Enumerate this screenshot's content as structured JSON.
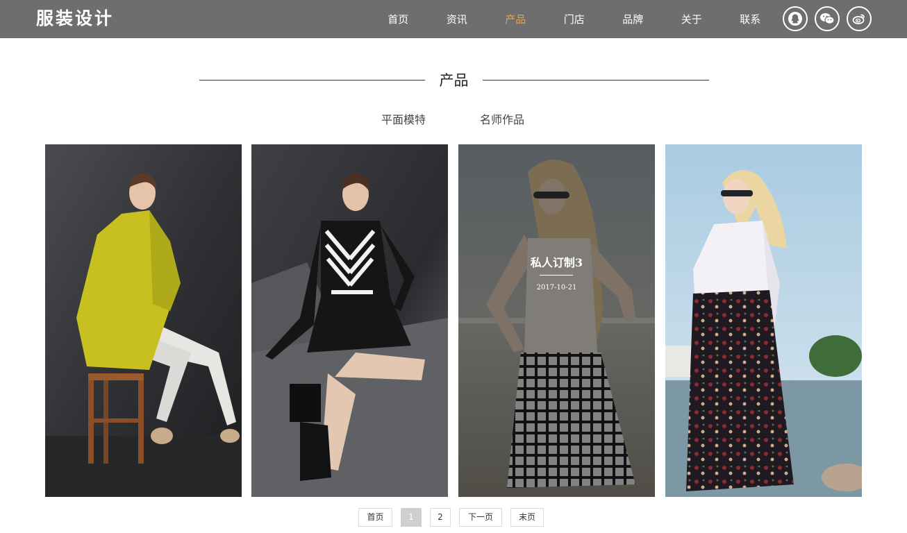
{
  "header": {
    "logo": "服装设计",
    "nav": [
      {
        "label": "首页"
      },
      {
        "label": "资讯"
      },
      {
        "label": "产品"
      },
      {
        "label": "门店"
      },
      {
        "label": "品牌"
      },
      {
        "label": "关于"
      },
      {
        "label": "联系"
      }
    ],
    "active_nav": "产品",
    "active_color": "#e0a84c",
    "social_icons": [
      "qq-icon",
      "wechat-icon",
      "weibo-icon"
    ]
  },
  "section": {
    "title": "产品",
    "categories": [
      {
        "label": "平面模特"
      },
      {
        "label": "名师作品"
      }
    ]
  },
  "gallery": {
    "items": [
      {
        "image": "model-yellow-coat-photo"
      },
      {
        "image": "model-striped-dress-photo"
      },
      {
        "image": "model-checkered-skirt-photo",
        "title": "私人订制3",
        "date": "2017-10-21"
      },
      {
        "image": "model-floral-skirt-photo"
      }
    ]
  },
  "pagination": {
    "first": "首页",
    "pages": [
      "1",
      "2"
    ],
    "current": "1",
    "next": "下一页",
    "last": "末页"
  }
}
